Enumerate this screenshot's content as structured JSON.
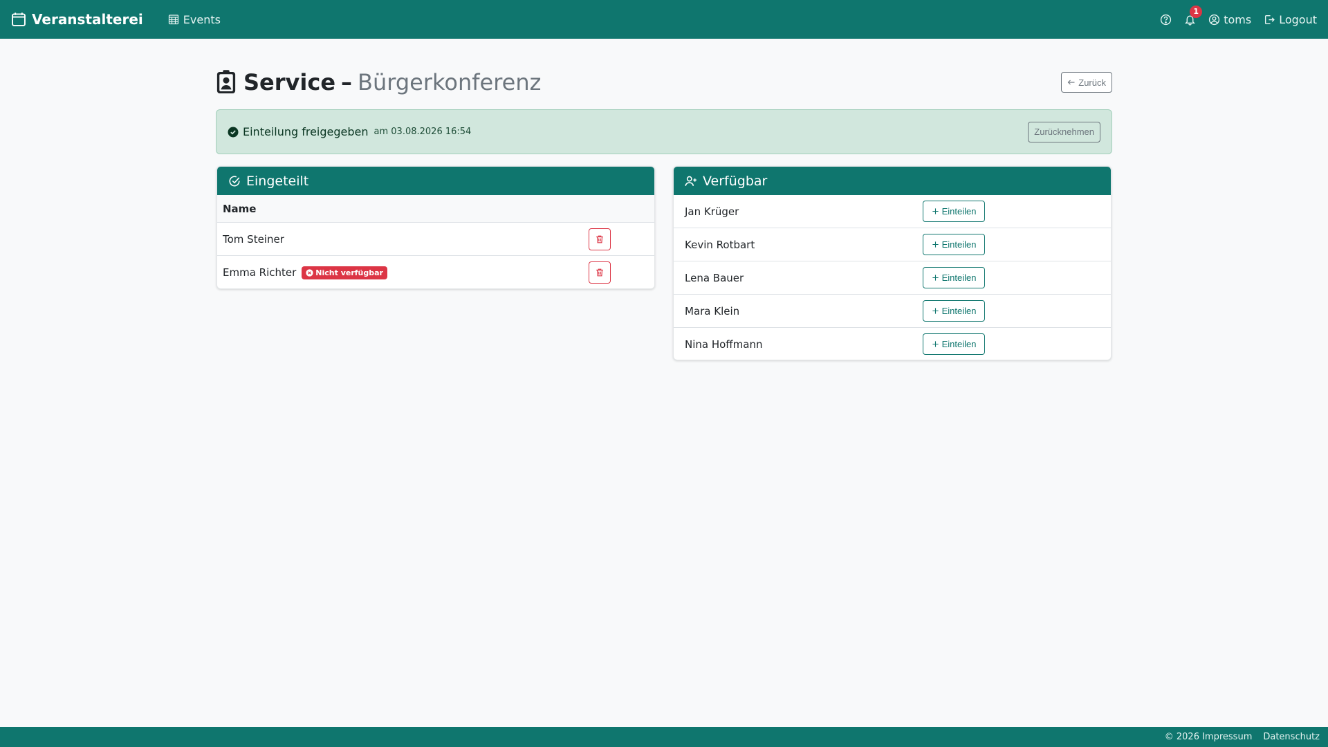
{
  "navbar": {
    "brand": "Veranstalterei",
    "events_label": "Events",
    "notification_count": "1",
    "user": "toms",
    "logout_label": "Logout"
  },
  "header": {
    "title": "Service",
    "dash": "–",
    "subtitle": "Bürgerkonferenz",
    "back_label": "Zurück"
  },
  "alert": {
    "text": "Einteilung freigegeben",
    "date": "am 03.08.2026 16:54",
    "revoke_label": "Zurücknehmen"
  },
  "assigned": {
    "title": "Eingeteilt",
    "column_name": "Name",
    "rows": [
      {
        "name": "Tom Steiner",
        "badge": ""
      },
      {
        "name": "Emma Richter",
        "badge": "Nicht verfügbar"
      }
    ]
  },
  "available": {
    "title": "Verfügbar",
    "assign_label": "Einteilen",
    "rows": [
      {
        "name": "Jan Krüger"
      },
      {
        "name": "Kevin Rotbart"
      },
      {
        "name": "Lena Bauer"
      },
      {
        "name": "Mara Klein"
      },
      {
        "name": "Nina Hoffmann"
      }
    ]
  },
  "footer": {
    "impressum": "© 2026 Impressum",
    "datenschutz": "Datenschutz"
  },
  "colors": {
    "primary": "#0f766e",
    "danger": "#dc3545",
    "success_bg": "#d1e7dd"
  }
}
